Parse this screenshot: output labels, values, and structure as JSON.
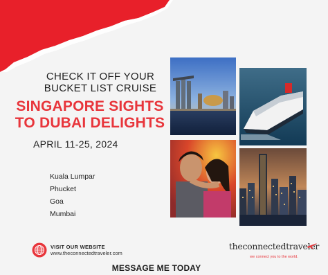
{
  "headline": {
    "line1": "CHECK IT OFF YOUR",
    "line2": "BUCKET LIST CRUISE"
  },
  "cruise_title": {
    "line1": "SINGAPORE SIGHTS",
    "line2": "TO DUBAI DELIGHTS"
  },
  "dates": "APRIL 11-25, 2024",
  "ports": [
    "Kuala Lumpar",
    "Phucket",
    "Goa",
    "Mumbai"
  ],
  "website": {
    "label": "VISIT OUR WEBSITE",
    "url": "www.theconnectedtraveler.com",
    "icon": "globe-icon"
  },
  "message": "MESSAGE ME TODAY",
  "brand": {
    "name": "theconnectedtraveler",
    "tagline": "we connect you to the world.",
    "icon": "airplane-icon"
  },
  "colors": {
    "accent": "#e8353b",
    "text": "#1d1d1d",
    "background": "#f4f4f4"
  }
}
